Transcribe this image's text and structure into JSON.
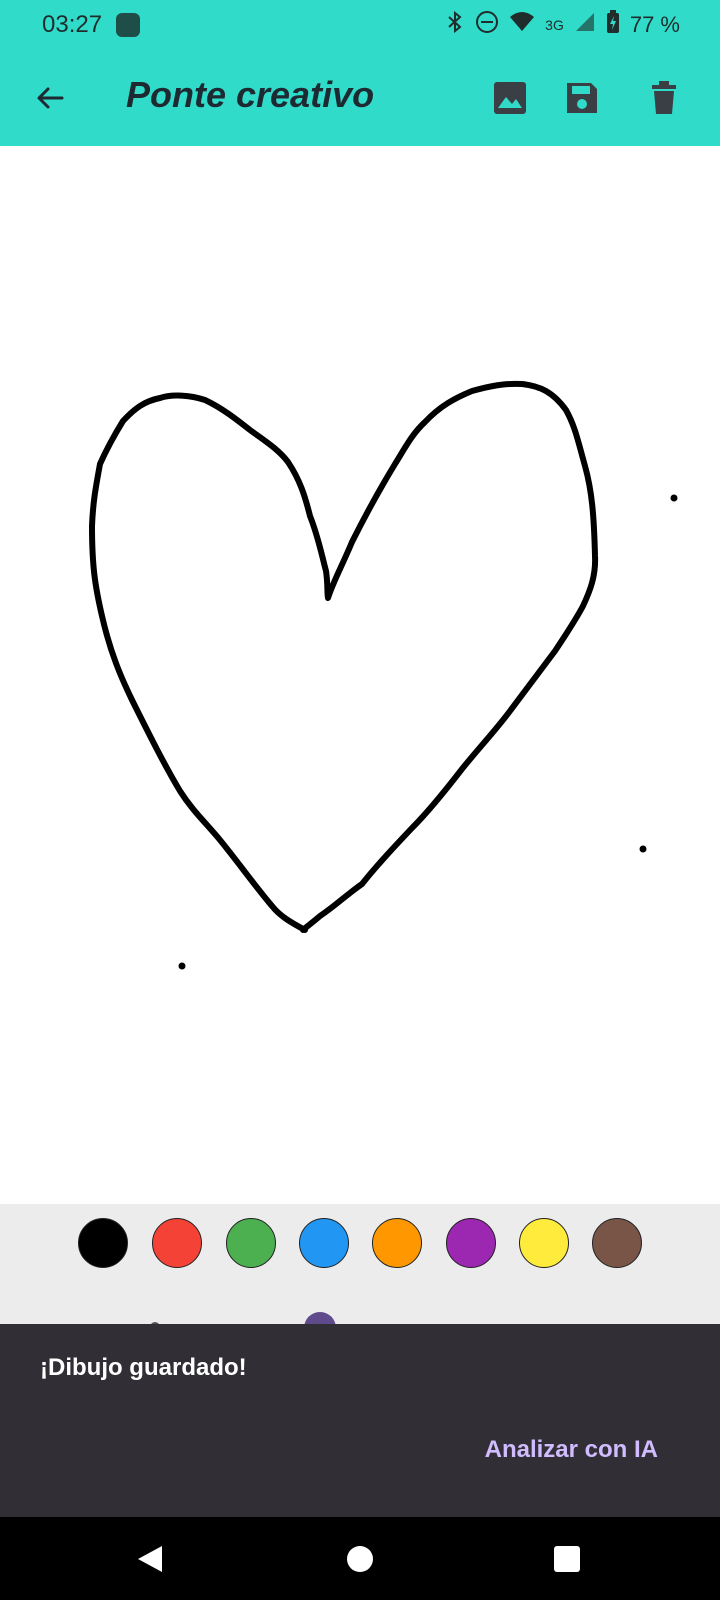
{
  "status_bar": {
    "time": "03:27",
    "network": "3G",
    "battery": "77 %",
    "icons": [
      "bluetooth-icon",
      "dnd-icon",
      "wifi-icon",
      "signal-icon",
      "battery-charging-icon"
    ]
  },
  "app_bar": {
    "title": "Ponte creativo",
    "background_color": "#30dbc9",
    "actions": [
      "image-icon",
      "save-icon",
      "delete-icon"
    ]
  },
  "palette": {
    "colors": [
      "#000000",
      "#f44336",
      "#4caf50",
      "#2196f3",
      "#ff9800",
      "#9c27b0",
      "#ffeb3b",
      "#795548"
    ],
    "selected_color": "#000000"
  },
  "snackbar": {
    "message": "¡Dibujo guardado!",
    "action_label": "Analizar con IA"
  },
  "nav_bar": {
    "buttons": [
      "back-triangle-icon",
      "home-circle-icon",
      "recents-square-icon"
    ]
  }
}
